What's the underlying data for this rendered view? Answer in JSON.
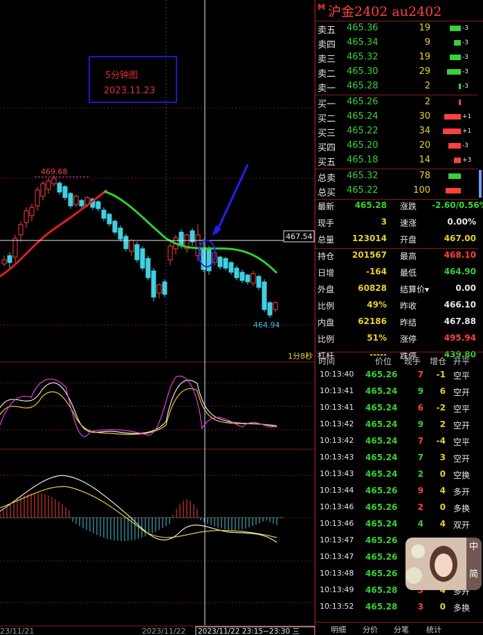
{
  "instrument": {
    "title": "沪金2402  au2402",
    "badge": "M"
  },
  "chart": {
    "annotation_line1": "5分钟图",
    "annotation_line2": "2023.11.23",
    "high_label": "469.68",
    "low_label": "464.94",
    "crosshair_price": "467.54",
    "countdown": "1分8秒",
    "date_left": "23/11/21",
    "date_mid": "2023/11/22",
    "date_cursor": "2023/11/22 23:15~23:30 三"
  },
  "orderbook": {
    "asks": [
      {
        "label": "卖五",
        "price": "465.36",
        "vol": "19",
        "chg": "-3"
      },
      {
        "label": "卖四",
        "price": "465.34",
        "vol": "9",
        "chg": "-3"
      },
      {
        "label": "卖三",
        "price": "465.32",
        "vol": "19",
        "chg": "-3"
      },
      {
        "label": "卖二",
        "price": "465.30",
        "vol": "29",
        "chg": "-3"
      },
      {
        "label": "卖一",
        "price": "465.28",
        "vol": "2",
        "chg": "-3"
      }
    ],
    "bids": [
      {
        "label": "买一",
        "price": "465.26",
        "vol": "2",
        "chg": ""
      },
      {
        "label": "买二",
        "price": "465.24",
        "vol": "30",
        "chg": "+1"
      },
      {
        "label": "买三",
        "price": "465.22",
        "vol": "34",
        "chg": "+1"
      },
      {
        "label": "买四",
        "price": "465.20",
        "vol": "20",
        "chg": "-3"
      },
      {
        "label": "买五",
        "price": "465.18",
        "vol": "14",
        "chg": "+3"
      }
    ],
    "totals": [
      {
        "label": "总卖",
        "price": "465.32",
        "vol": "78"
      },
      {
        "label": "总买",
        "price": "465.22",
        "vol": "100"
      }
    ]
  },
  "quote": [
    {
      "l1": "最新",
      "v1": "465.28",
      "c1": "#36d236",
      "l2": "涨跌",
      "v2": "-2.60/0.56%",
      "c2": "#36d236"
    },
    {
      "l1": "现手",
      "v1": "3",
      "c1": "#e8d030",
      "l2": "速涨",
      "v2": "0.00%",
      "c2": "#e8e8e8"
    },
    {
      "l1": "总量",
      "v1": "123014",
      "c1": "#e8d030",
      "l2": "开盘",
      "v2": "467.00",
      "c2": "#e8d030"
    },
    {
      "l1": "持仓",
      "v1": "201567",
      "c1": "#e8d030",
      "l2": "最高",
      "v2": "468.10",
      "c2": "#ff4040"
    },
    {
      "l1": "日增",
      "v1": "-164",
      "c1": "#e8d030",
      "l2": "最低",
      "v2": "464.90",
      "c2": "#36d236"
    },
    {
      "l1": "外盘",
      "v1": "60828",
      "c1": "#e8d030",
      "l2": "结算价▾",
      "v2": "0.00",
      "c2": "#e8e8e8"
    },
    {
      "l1": "比例",
      "v1": "49%",
      "c1": "#e8d030",
      "l2": "昨收",
      "v2": "466.10",
      "c2": "#e8e8e8"
    },
    {
      "l1": "内盘",
      "v1": "62186",
      "c1": "#e8d030",
      "l2": "昨结",
      "v2": "467.88",
      "c2": "#e8e8e8"
    },
    {
      "l1": "比例",
      "v1": "51%",
      "c1": "#e8d030",
      "l2": "涨停",
      "v2": "495.94",
      "c2": "#ff4040"
    },
    {
      "l1": "杠杆",
      "v1": "-----",
      "c1": "#e8d030",
      "l2": "跌停",
      "v2": "439.80",
      "c2": "#36d236"
    }
  ],
  "trades_header": {
    "time": "时间",
    "price": "价位",
    "vol": "现手",
    "oi": "增仓",
    "kind": "开平"
  },
  "trades": [
    {
      "time": "10:13:40",
      "price": "465.26",
      "vol": "7",
      "vc": "red",
      "oi": "-1",
      "kind": "空平"
    },
    {
      "time": "10:13:41",
      "price": "465.24",
      "vol": "9",
      "vc": "green",
      "oi": "6",
      "kind": "空开"
    },
    {
      "time": "10:13:41",
      "price": "465.24",
      "vol": "6",
      "vc": "red",
      "oi": "-2",
      "kind": "空平"
    },
    {
      "time": "10:13:42",
      "price": "465.24",
      "vol": "9",
      "vc": "green",
      "oi": "2",
      "kind": "空开"
    },
    {
      "time": "10:13:42",
      "price": "465.24",
      "vol": "7",
      "vc": "red",
      "oi": "-4",
      "kind": "空平"
    },
    {
      "time": "10:13:43",
      "price": "465.24",
      "vol": "7",
      "vc": "green",
      "oi": "3",
      "kind": "空开"
    },
    {
      "time": "10:13:43",
      "price": "465.24",
      "vol": "2",
      "vc": "green",
      "oi": "0",
      "kind": "空换"
    },
    {
      "time": "10:13:44",
      "price": "465.26",
      "vol": "9",
      "vc": "red",
      "oi": "4",
      "kind": "多开"
    },
    {
      "time": "10:13:46",
      "price": "465.26",
      "vol": "2",
      "vc": "red",
      "oi": "0",
      "kind": "多换"
    },
    {
      "time": "10:13:46",
      "price": "465.24",
      "vol": "4",
      "vc": "green",
      "oi": "4",
      "kind": "双开"
    },
    {
      "time": "10:13:47",
      "price": "465.26",
      "vol": "",
      "vc": "red",
      "oi": "",
      "kind": ""
    },
    {
      "time": "10:13:47",
      "price": "465.26",
      "vol": "",
      "vc": "red",
      "oi": "",
      "kind": ""
    },
    {
      "time": "10:13:48",
      "price": "465.26",
      "vol": "",
      "vc": "red",
      "oi": "",
      "kind": ""
    },
    {
      "time": "10:13:49",
      "price": "465.28",
      "vol": "3",
      "vc": "red",
      "oi": "4",
      "kind": "多开"
    },
    {
      "time": "10:13:52",
      "price": "465.28",
      "vol": "3",
      "vc": "red",
      "oi": "0",
      "kind": "多换"
    }
  ],
  "tabs": [
    "明细",
    "分价",
    "分笔",
    "统计"
  ],
  "widget": {
    "top": "中",
    "bottom": "简"
  },
  "colors": {
    "up": "#ff4040",
    "down": "#36d236",
    "accent": "#e8d030",
    "frame": "#8a1a1a",
    "annotation": "#1a1acc"
  }
}
